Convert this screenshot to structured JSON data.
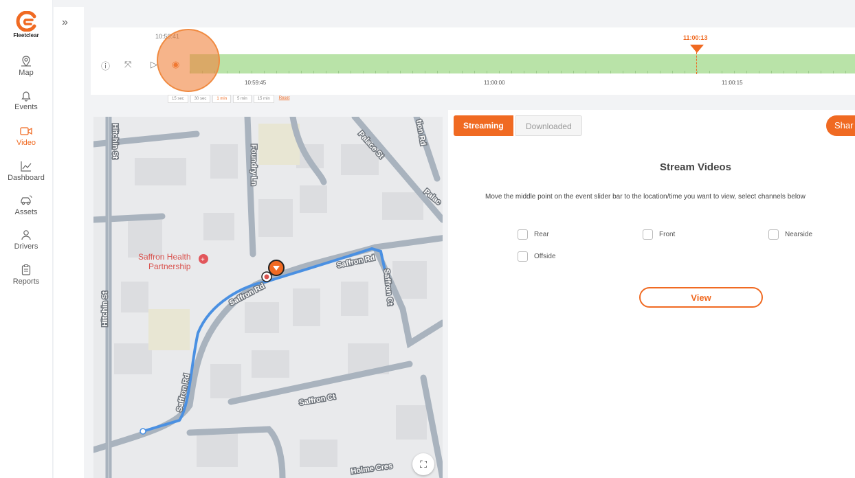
{
  "app": {
    "brand": "Fleetclear",
    "accent": "#f06a22"
  },
  "sidebar": {
    "items": [
      {
        "label": "Map",
        "icon": "map-pin-icon",
        "active": false
      },
      {
        "label": "Events",
        "icon": "bell-icon",
        "active": false
      },
      {
        "label": "Video",
        "icon": "video-camera-icon",
        "active": true
      },
      {
        "label": "Dashboard",
        "icon": "line-chart-icon",
        "active": false
      },
      {
        "label": "Assets",
        "icon": "car-icon",
        "active": false
      },
      {
        "label": "Drivers",
        "icon": "user-icon",
        "active": false
      },
      {
        "label": "Reports",
        "icon": "clipboard-icon",
        "active": false
      }
    ],
    "collapse_glyph": "»"
  },
  "timeline": {
    "start_time": "10:59:41",
    "marker_time": "11:00:13",
    "tick_labels": [
      "10:59:45",
      "11:00:00",
      "11:00:15"
    ],
    "zoom_options": [
      "15 sec",
      "30 sec",
      "1 min",
      "5 min",
      "15 min"
    ],
    "zoom_selected": "1 min",
    "reset_label": "Reset"
  },
  "map": {
    "streets": [
      "Hitchin St",
      "Foundry Ln",
      "Palace St",
      "Saffron Rd",
      "Saffron Ct",
      "Holme Cres"
    ],
    "poi": "Saffron Health Partnership",
    "poi_lines": [
      "Saffron Health",
      "Partnership"
    ],
    "clipped_labels": [
      "tion Rd",
      "Palac"
    ]
  },
  "panel": {
    "tabs": [
      "Streaming",
      "Downloaded"
    ],
    "active_tab": "Streaming",
    "share_label": "Shar",
    "title": "Stream Videos",
    "instructions": "Move the middle point on the event slider bar to the location/time you want to view, select channels below",
    "channels": [
      "Rear",
      "Front",
      "Nearside",
      "Offside"
    ],
    "view_label": "View"
  }
}
